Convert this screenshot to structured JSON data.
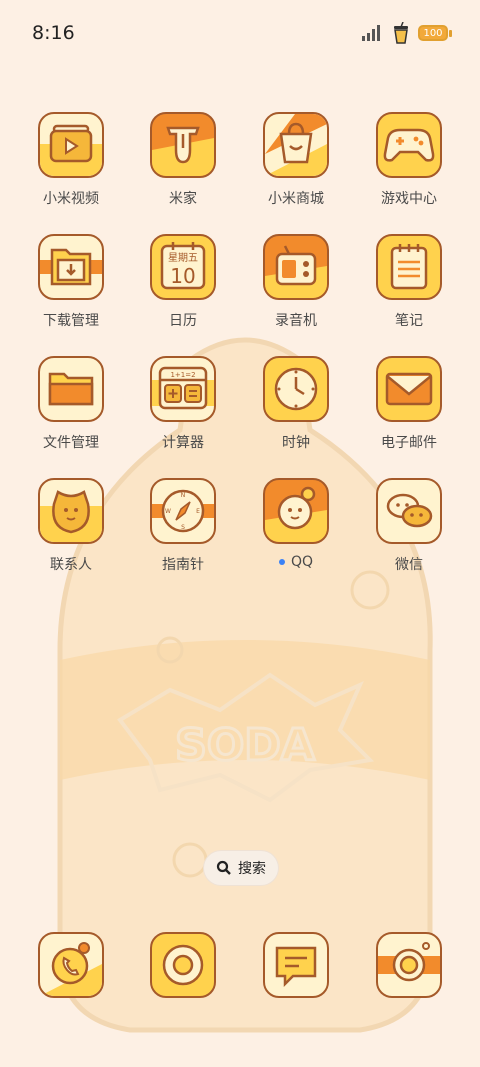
{
  "status": {
    "time": "8:16",
    "battery": "100"
  },
  "apps": [
    {
      "label": "小米视频"
    },
    {
      "label": "米家"
    },
    {
      "label": "小米商城"
    },
    {
      "label": "游戏中心"
    },
    {
      "label": "下载管理"
    },
    {
      "label": "日历"
    },
    {
      "label": "录音机"
    },
    {
      "label": "笔记"
    },
    {
      "label": "文件管理"
    },
    {
      "label": "计算器"
    },
    {
      "label": "时钟"
    },
    {
      "label": "电子邮件"
    },
    {
      "label": "联系人"
    },
    {
      "label": "指南针"
    },
    {
      "label": "QQ"
    },
    {
      "label": "微信"
    }
  ],
  "calendar": {
    "weekday": "星期五",
    "day": "10"
  },
  "calculator": {
    "equation": "1+1=2"
  },
  "wallpaper": {
    "text": "SODA"
  },
  "search": {
    "label": "搜索"
  },
  "dock": [
    "phone",
    "browser",
    "messages",
    "camera"
  ],
  "colors": {
    "orange": "#f28b2c",
    "yellow": "#ffd24d",
    "cream": "#fff3cf",
    "outline": "#a55a2a",
    "background": "#fdf0e4"
  }
}
